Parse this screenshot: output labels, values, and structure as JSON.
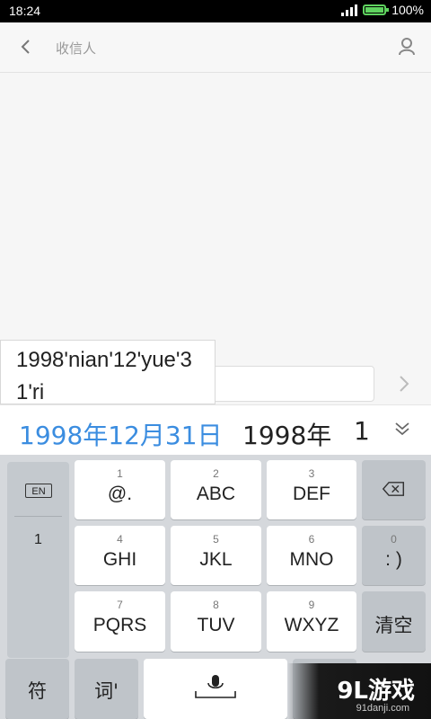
{
  "status": {
    "time": "18:24",
    "battery": "100%",
    "battery_level": 1.0
  },
  "header": {
    "recipient_placeholder": "收信人"
  },
  "ime": {
    "pinyin": "1998'nian'12'yue'31'ri",
    "candidates": [
      "1998年12月31日",
      "1998年",
      "1"
    ]
  },
  "keyboard": {
    "en_label": "EN",
    "side_digit": "1",
    "keys": [
      {
        "num": "1",
        "label": "@."
      },
      {
        "num": "2",
        "label": "ABC"
      },
      {
        "num": "3",
        "label": "DEF"
      },
      {
        "num": "4",
        "label": "GHI"
      },
      {
        "num": "5",
        "label": "JKL"
      },
      {
        "num": "6",
        "label": "MNO"
      },
      {
        "num": "0",
        "label": ": )"
      },
      {
        "num": "7",
        "label": "PQRS"
      },
      {
        "num": "8",
        "label": "TUV"
      },
      {
        "num": "9",
        "label": "WXYZ"
      }
    ],
    "clear_label": "清空",
    "symbol_label": "符",
    "word_label": "词'"
  },
  "watermark": {
    "text": "9L游戏",
    "sub": "91danji.com"
  }
}
